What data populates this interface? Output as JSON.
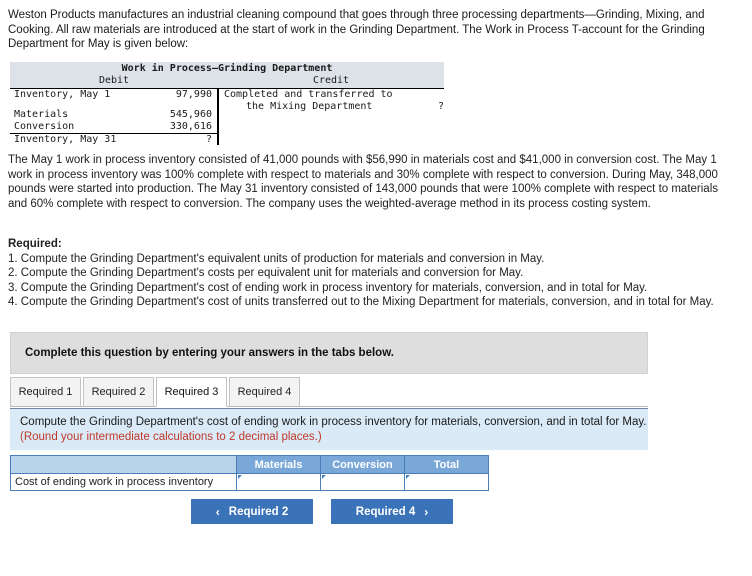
{
  "intro": {
    "paragraph": "Weston Products manufactures an industrial cleaning compound that goes through three processing departments—Grinding, Mixing, and Cooking. All raw materials are introduced at the start of work in the Grinding Department. The Work in Process T-account for the Grinding Department for May is given below:"
  },
  "taccount": {
    "title": "Work in Process—Grinding Department",
    "debit_header": "Debit",
    "credit_header": "Credit",
    "debit_rows": [
      {
        "label": "Inventory, May 1",
        "amount": "97,990"
      },
      {
        "label": "Materials",
        "amount": "545,960"
      },
      {
        "label": "Conversion",
        "amount": "330,616"
      },
      {
        "label": "Inventory, May 31",
        "amount": "?"
      }
    ],
    "credit_line1": "Completed and transferred to",
    "credit_line2": "the Mixing Department",
    "credit_amount": "?"
  },
  "body": {
    "paragraph": "The May 1 work in process inventory consisted of 41,000 pounds with $56,990 in materials cost and $41,000 in conversion cost. The May 1 work in process inventory was 100% complete with respect to materials and 30% complete with respect to conversion. During May, 348,000 pounds were started into production. The May 31 inventory consisted of 143,000 pounds that were 100% complete with respect to materials and 60% complete with respect to conversion. The company uses the weighted-average method in its process costing system."
  },
  "required": {
    "title": "Required:",
    "items": [
      "1. Compute the Grinding Department's equivalent units of production for materials and conversion in May.",
      "2. Compute the Grinding Department's costs per equivalent unit for materials and conversion for May.",
      "3. Compute the Grinding Department's cost of ending work in process inventory for materials, conversion, and in total for May.",
      "4. Compute the Grinding Department's cost of units transferred out to the Mixing Department for materials, conversion, and in total for May."
    ]
  },
  "banner": {
    "text": "Complete this question by entering your answers in the tabs below."
  },
  "tabs": {
    "items": [
      {
        "label": "Required 1",
        "active": false
      },
      {
        "label": "Required 2",
        "active": false
      },
      {
        "label": "Required 3",
        "active": true
      },
      {
        "label": "Required 4",
        "active": false
      }
    ]
  },
  "instruction": {
    "line1": "Compute the Grinding Department's cost of ending work in process inventory for materials, conversion, and in total for May.",
    "line2": "(Round your intermediate calculations to 2 decimal places.)"
  },
  "answer_table": {
    "blank_header": "",
    "headers": [
      "Materials",
      "Conversion",
      "Total"
    ],
    "row_label": "Cost of ending work in process inventory",
    "values": [
      "",
      "",
      ""
    ]
  },
  "nav": {
    "prev_label": "Required 2",
    "next_label": "Required 4",
    "prev_icon": "chevron-left",
    "next_icon": "chevron-right",
    "prev_glyph": "‹",
    "next_glyph": "›"
  },
  "colors": {
    "button_blue": "#3b73b9",
    "table_header_blue": "#79a7d8",
    "panel_blue": "#daeaf7",
    "banner_gray": "#dededf",
    "alert_red": "#c0392b"
  }
}
